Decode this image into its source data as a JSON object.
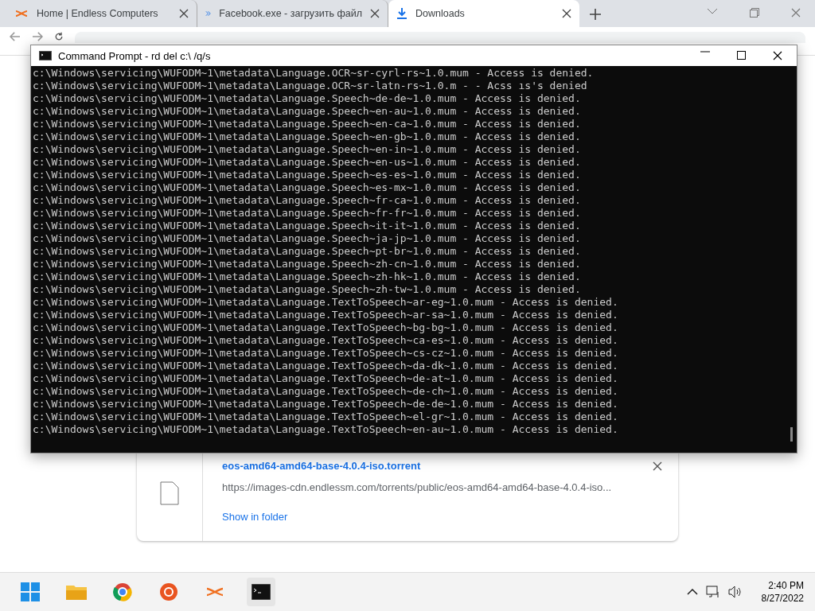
{
  "browser": {
    "tabs": [
      {
        "title": "Home | Endless Computers",
        "selected": false
      },
      {
        "title": "Facebook.exe - загрузить файл",
        "selected": false
      },
      {
        "title": "Downloads",
        "selected": true
      }
    ]
  },
  "downloads": {
    "items": [
      {
        "filename": "eos-amd64-amd64-base-4.0.4-iso.torrent",
        "url": "https://images-cdn.endlessm.com/torrents/public/eos-amd64-amd64-base-4.0.4-iso...",
        "action": "Show in folder"
      }
    ]
  },
  "console_window": {
    "title": "Command Prompt - rd  del c:\\ /q/s",
    "lines": [
      "c:\\Windows\\servicing\\WUFODM~1\\metadata\\Language.OCR~sr-cyrl-rs~1.0.mum - Access is denied.",
      "c:\\Windows\\servicing\\WUFODM~1\\metadata\\Language.OCR~sr-latn-rs~1.0.m - - Acss ıs's denied",
      "c:\\Windows\\servicing\\WUFODM~1\\metadata\\Language.Speech~de-de~1.0.mum - Access is denied.",
      "c:\\Windows\\servicing\\WUFODM~1\\metadata\\Language.Speech~en-au~1.0.mum - Access is denied.",
      "c:\\Windows\\servicing\\WUFODM~1\\metadata\\Language.Speech~en-ca~1.0.mum - Access is denied.",
      "c:\\Windows\\servicing\\WUFODM~1\\metadata\\Language.Speech~en-gb~1.0.mum - Access is denied.",
      "c:\\Windows\\servicing\\WUFODM~1\\metadata\\Language.Speech~en-in~1.0.mum - Access is denied.",
      "c:\\Windows\\servicing\\WUFODM~1\\metadata\\Language.Speech~en-us~1.0.mum - Access is denied.",
      "c:\\Windows\\servicing\\WUFODM~1\\metadata\\Language.Speech~es-es~1.0.mum - Access is denied.",
      "c:\\Windows\\servicing\\WUFODM~1\\metadata\\Language.Speech~es-mx~1.0.mum - Access is denied.",
      "c:\\Windows\\servicing\\WUFODM~1\\metadata\\Language.Speech~fr-ca~1.0.mum - Access is denied.",
      "c:\\Windows\\servicing\\WUFODM~1\\metadata\\Language.Speech~fr-fr~1.0.mum - Access is denied.",
      "c:\\Windows\\servicing\\WUFODM~1\\metadata\\Language.Speech~it-it~1.0.mum - Access is denied.",
      "c:\\Windows\\servicing\\WUFODM~1\\metadata\\Language.Speech~ja-jp~1.0.mum - Access is denied.",
      "c:\\Windows\\servicing\\WUFODM~1\\metadata\\Language.Speech~pt-br~1.0.mum - Access is denied.",
      "c:\\Windows\\servicing\\WUFODM~1\\metadata\\Language.Speech~zh-cn~1.0.mum - Access is denied.",
      "c:\\Windows\\servicing\\WUFODM~1\\metadata\\Language.Speech~zh-hk~1.0.mum - Access is denied.",
      "c:\\Windows\\servicing\\WUFODM~1\\metadata\\Language.Speech~zh-tw~1.0.mum - Access is denied.",
      "c:\\Windows\\servicing\\WUFODM~1\\metadata\\Language.TextToSpeech~ar-eg~1.0.mum - Access is denied.",
      "c:\\Windows\\servicing\\WUFODM~1\\metadata\\Language.TextToSpeech~ar-sa~1.0.mum - Access is denied.",
      "c:\\Windows\\servicing\\WUFODM~1\\metadata\\Language.TextToSpeech~bg-bg~1.0.mum - Access is denied.",
      "c:\\Windows\\servicing\\WUFODM~1\\metadata\\Language.TextToSpeech~ca-es~1.0.mum - Access is denied.",
      "c:\\Windows\\servicing\\WUFODM~1\\metadata\\Language.TextToSpeech~cs-cz~1.0.mum - Access is denied.",
      "c:\\Windows\\servicing\\WUFODM~1\\metadata\\Language.TextToSpeech~da-dk~1.0.mum - Access is denied.",
      "c:\\Windows\\servicing\\WUFODM~1\\metadata\\Language.TextToSpeech~de-at~1.0.mum - Access is denied.",
      "c:\\Windows\\servicing\\WUFODM~1\\metadata\\Language.TextToSpeech~de-ch~1.0.mum - Access is denied.",
      "c:\\Windows\\servicing\\WUFODM~1\\metadata\\Language.TextToSpeech~de-de~1.0.mum - Access is denied.",
      "c:\\Windows\\servicing\\WUFODM~1\\metadata\\Language.TextToSpeech~el-gr~1.0.mum - Access is denied.",
      "c:\\Windows\\servicing\\WUFODM~1\\metadata\\Language.TextToSpeech~en-au~1.0.mum - Access is denied."
    ]
  },
  "taskbar": {
    "time": "2:40 PM",
    "date": "8/27/2022"
  }
}
